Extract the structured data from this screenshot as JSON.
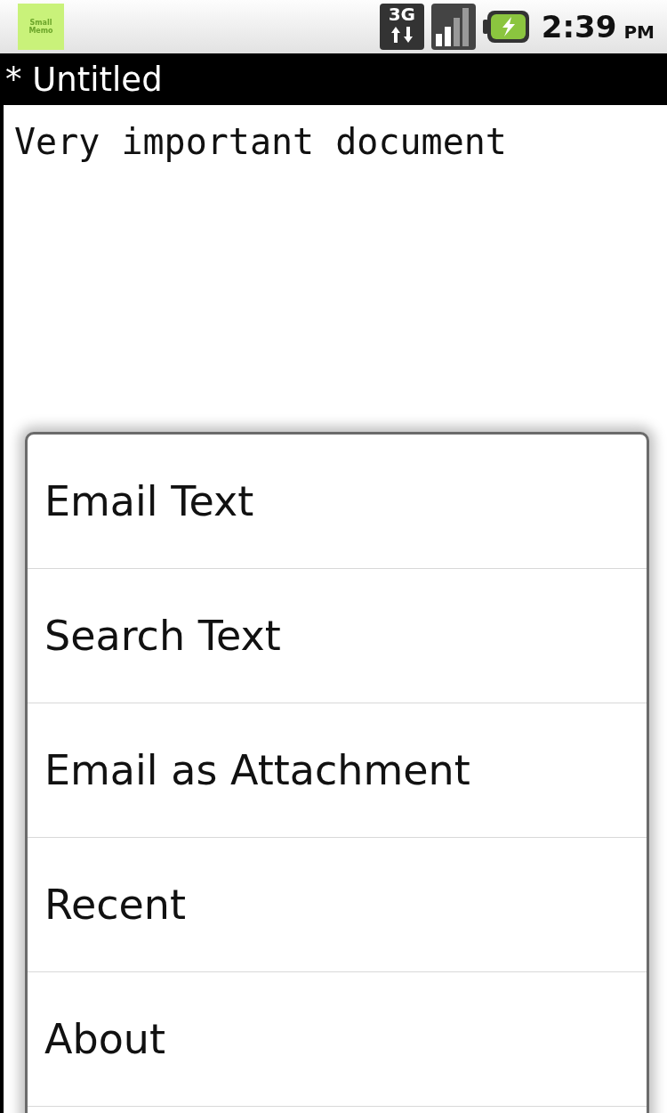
{
  "status_bar": {
    "app_icon_label": "Small Memo",
    "network_type": "3G",
    "time": "2:39",
    "am_pm": "PM",
    "charging": true
  },
  "title_bar": {
    "title": "* Untitled"
  },
  "editor": {
    "value": "Very important document"
  },
  "menu": {
    "items": [
      {
        "label": "Email Text"
      },
      {
        "label": "Search Text"
      },
      {
        "label": "Email as Attachment"
      },
      {
        "label": "Recent"
      },
      {
        "label": "About"
      }
    ]
  }
}
